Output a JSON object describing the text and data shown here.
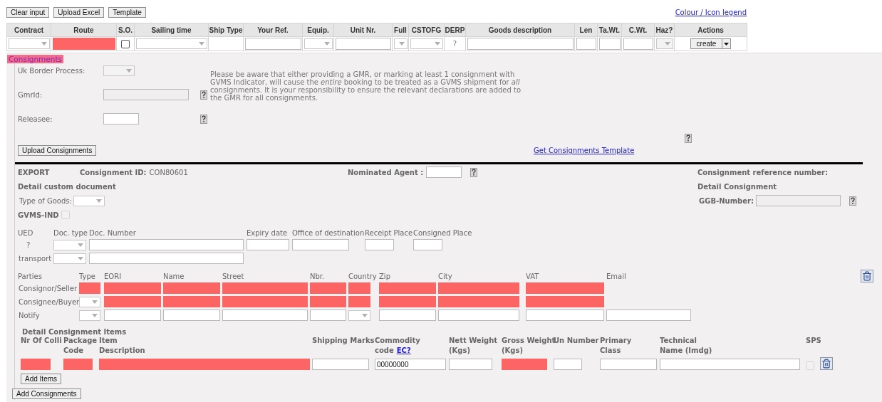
{
  "toolbar": {
    "buttons": [
      "Clear input",
      "Upload Excel",
      "Template"
    ],
    "legend_link": "Colour / Icon legend"
  },
  "booking": {
    "columns": [
      {
        "label": "Contract",
        "cell": {
          "kind": "select"
        }
      },
      {
        "label": "Route",
        "cell": {
          "kind": "input",
          "required": true
        }
      },
      {
        "label": "S.O.",
        "cell": {
          "kind": "checkbox",
          "checked": false
        }
      },
      {
        "label": "Sailing time",
        "cell": {
          "kind": "select"
        }
      },
      {
        "label": "Ship Type",
        "cell": {
          "kind": "empty"
        }
      },
      {
        "label": "Your Ref.",
        "cell": {
          "kind": "input",
          "required": false
        }
      },
      {
        "label": "Equip.",
        "cell": {
          "kind": "select"
        }
      },
      {
        "label": "Unit Nr.",
        "cell": {
          "kind": "input",
          "required": false
        }
      },
      {
        "label": "Full",
        "cell": {
          "kind": "select"
        }
      },
      {
        "label": "CSTOFG",
        "cell": {
          "kind": "select"
        }
      },
      {
        "label": "DERP",
        "cell": {
          "kind": "text",
          "text": "?"
        }
      },
      {
        "label": "Goods description",
        "cell": {
          "kind": "input",
          "required": false
        }
      },
      {
        "label": "Len",
        "cell": {
          "kind": "input",
          "required": false
        }
      },
      {
        "label": "Ta.Wt.",
        "cell": {
          "kind": "input",
          "required": false
        }
      },
      {
        "label": "C.Wt.",
        "cell": {
          "kind": "input",
          "required": false
        }
      },
      {
        "label": "Haz?",
        "cell": {
          "kind": "select",
          "disabled": true
        }
      },
      {
        "label": "Actions",
        "cell": {
          "kind": "actions",
          "text": "create"
        }
      }
    ]
  },
  "consignments_tab": "Consignments",
  "border_fields": [
    {
      "label": "Uk Border Process:",
      "field": {
        "kind": "select",
        "disabled": true
      },
      "help": false
    },
    {
      "label": "GmrId:",
      "field": {
        "kind": "input",
        "required": false,
        "disabled": true
      },
      "help": true
    },
    {
      "label": "Releasee:",
      "field": {
        "kind": "input",
        "required": false,
        "disabled": false
      },
      "help": true
    }
  ],
  "notice": "Please be aware that either providing a GMR, or marking at least 1 consignment with GVMS Indicator, will cause the *entire* booking to be treated as a GVMS shipment for *all* consignments. It is your responsibility to ensure the relevant declarations are added to the GMR for all consignments.",
  "upload_button": "Upload Consignments",
  "template_link": "Get Consignments Template",
  "consignment": {
    "type": "EXPORT",
    "id_label": "Consignment ID:",
    "id_value": "CON80601",
    "agent_label": "Nominated Agent :",
    "reference_label": "Consignment reference number:",
    "custom_title": "Detail custom document",
    "detail_title": "Detail Consignment",
    "goods_label": "Type of Goods:",
    "ggb_label": "GGB-Number:",
    "gvms_label": "GVMS-IND",
    "gvms": {
      "kind": "checkbox",
      "checked": false,
      "disabled": true
    }
  },
  "documents": {
    "headers": [
      "UED",
      "Doc. type",
      "Doc. Number",
      "Expiry date",
      "Office of destination",
      "Receipt Place",
      "Consigned Place"
    ],
    "rows": [
      {
        "label": "?",
        "cells": [
          {
            "kind": "select"
          },
          {
            "kind": "input",
            "required": false
          },
          {
            "kind": "input",
            "required": false
          },
          {
            "kind": "input",
            "required": false
          },
          {
            "kind": "input",
            "required": false
          },
          {
            "kind": "input",
            "required": false
          }
        ]
      },
      {
        "label": "transport",
        "cells": [
          {
            "kind": "select"
          },
          {
            "kind": "input",
            "required": false
          }
        ]
      }
    ]
  },
  "parties": {
    "headers": [
      "Parties",
      "Type",
      "EORI",
      "Name",
      "Street",
      "Nbr.",
      "Country",
      "Zip",
      "City",
      "VAT",
      "Email"
    ],
    "rows": [
      {
        "label": "Consignor/Seller",
        "cells": [
          {
            "kind": "input",
            "required": true
          },
          {
            "kind": "input",
            "required": true
          },
          {
            "kind": "input",
            "required": true
          },
          {
            "kind": "input",
            "required": true
          },
          {
            "kind": "input",
            "required": true
          },
          {
            "kind": "input",
            "required": true
          },
          {
            "kind": "input",
            "required": true
          },
          {
            "kind": "input",
            "required": true
          },
          {
            "kind": "input",
            "required": true
          }
        ]
      },
      {
        "label": "Consignee/Buyer",
        "cells": [
          {
            "kind": "select"
          },
          {
            "kind": "input",
            "required": true
          },
          {
            "kind": "input",
            "required": true
          },
          {
            "kind": "input",
            "required": true
          },
          {
            "kind": "input",
            "required": true
          },
          {
            "kind": "input",
            "required": true
          },
          {
            "kind": "input",
            "required": true
          },
          {
            "kind": "input",
            "required": true
          },
          {
            "kind": "input",
            "required": true
          }
        ]
      },
      {
        "label": "Notify",
        "cells": [
          {
            "kind": "select"
          },
          {
            "kind": "input",
            "required": false
          },
          {
            "kind": "input",
            "required": false
          },
          {
            "kind": "input",
            "required": false
          },
          {
            "kind": "input",
            "required": false
          },
          {
            "kind": "select"
          },
          {
            "kind": "input",
            "required": false
          },
          {
            "kind": "input",
            "required": false
          },
          {
            "kind": "input",
            "required": false
          },
          {
            "kind": "input",
            "required": false
          }
        ]
      }
    ]
  },
  "items": {
    "title": "Detail Consignment Items",
    "columns": [
      {
        "lines": [
          "Nr Of Colli"
        ],
        "cell": {
          "kind": "input",
          "required": true
        }
      },
      {
        "lines": [
          "Package",
          "Code"
        ],
        "cell": {
          "kind": "input",
          "required": true
        }
      },
      {
        "lines": [
          "Item",
          "Description"
        ],
        "cell": {
          "kind": "input",
          "required": true
        }
      },
      {
        "lines": [
          "Shipping Marks"
        ],
        "cell": {
          "kind": "input",
          "required": false
        }
      },
      {
        "lines": [
          "Commodity",
          "code"
        ],
        "link": "EC?",
        "cell": {
          "kind": "input",
          "required": false,
          "value": "00000000"
        }
      },
      {
        "lines": [
          "Nett Weight",
          "(Kgs)"
        ],
        "cell": {
          "kind": "input",
          "required": false
        }
      },
      {
        "lines": [
          "Gross Weight",
          "(Kgs)"
        ],
        "cell": {
          "kind": "input",
          "required": true
        }
      },
      {
        "lines": [
          "Un Number"
        ],
        "cell": {
          "kind": "input",
          "required": false
        }
      },
      {
        "lines": [
          "Primary",
          "Class"
        ],
        "cell": {
          "kind": "input",
          "required": false
        }
      },
      {
        "lines": [
          "Technical",
          "Name (Imdg)"
        ],
        "cell": {
          "kind": "input",
          "required": false
        }
      },
      {
        "lines": [
          "SPS"
        ],
        "cell": {
          "kind": "checkbox",
          "checked": false,
          "disabled": true
        }
      }
    ],
    "add_button": "Add Items"
  },
  "add_consignments_button": "Add Consignments"
}
